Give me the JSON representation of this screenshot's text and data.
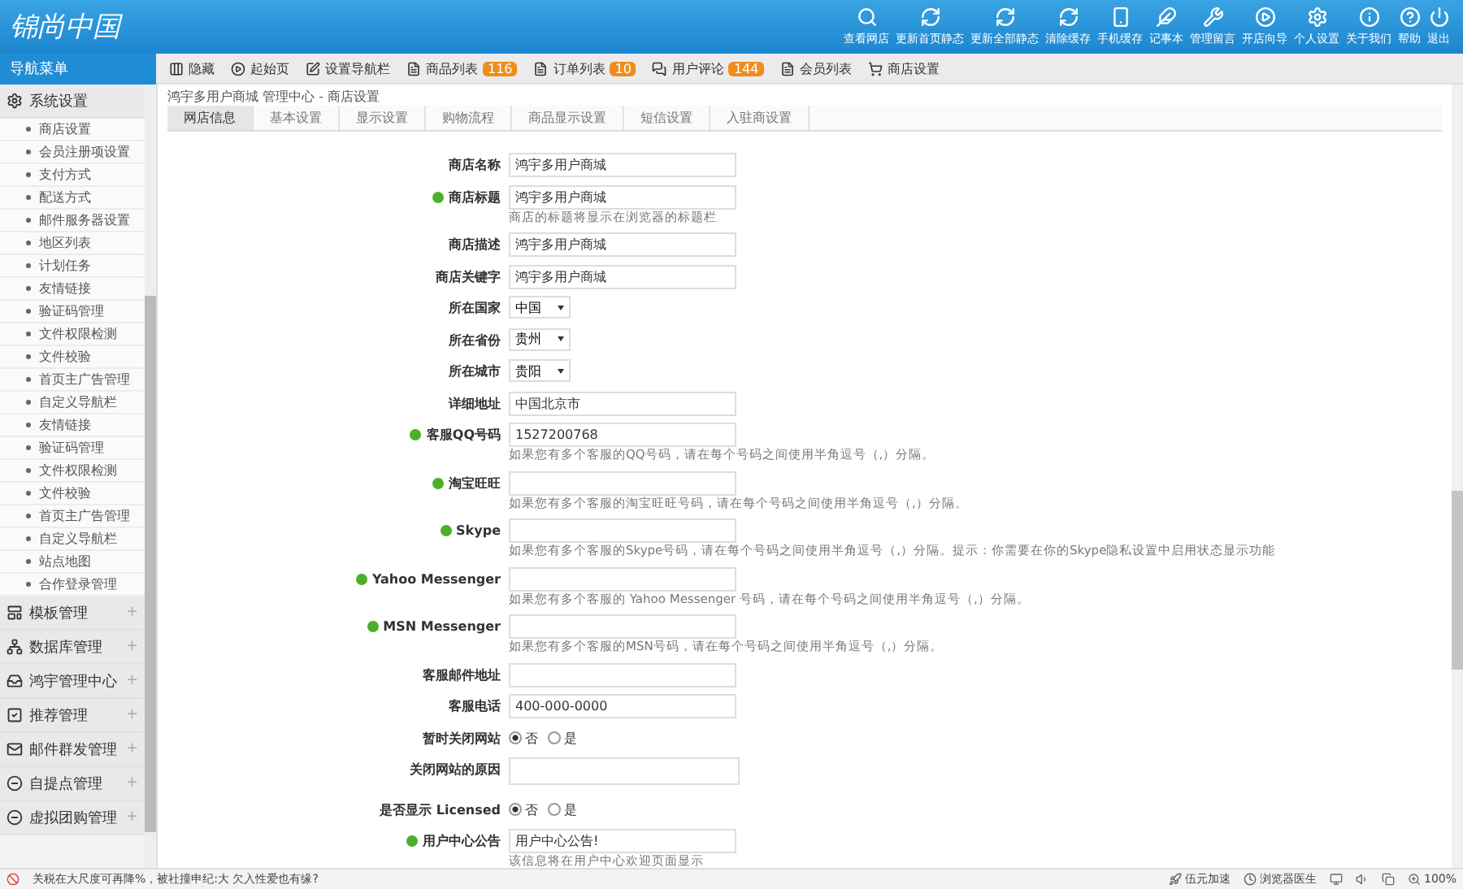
{
  "header": {
    "logo": "锦尚中国",
    "actions": [
      "查看网店",
      "更新首页静态",
      "更新全部静态",
      "清除缓存",
      "手机缓存",
      "记事本",
      "管理留言",
      "开店向导",
      "个人设置",
      "关于我们",
      "帮助",
      "退出"
    ]
  },
  "sidebar": {
    "title": "导航菜单",
    "groups": [
      {
        "label": "系统设置",
        "expanded": true,
        "children": [
          "商店设置",
          "会员注册项设置",
          "支付方式",
          "配送方式",
          "邮件服务器设置",
          "地区列表",
          "计划任务",
          "友情链接",
          "验证码管理",
          "文件权限检测",
          "文件校验",
          "首页主广告管理",
          "自定义导航栏",
          "友情链接",
          "验证码管理",
          "文件权限检测",
          "文件校验",
          "首页主广告管理",
          "自定义导航栏",
          "站点地图",
          "合作登录管理"
        ]
      },
      {
        "label": "模板管理",
        "expanded": false,
        "toggle": "+"
      },
      {
        "label": "数据库管理",
        "expanded": false,
        "toggle": "+"
      },
      {
        "label": "鸿宇管理中心",
        "expanded": false,
        "toggle": "+"
      },
      {
        "label": "推荐管理",
        "expanded": false,
        "toggle": "+"
      },
      {
        "label": "邮件群发管理",
        "expanded": false,
        "toggle": "+"
      },
      {
        "label": "自提点管理",
        "expanded": false,
        "toggle": "+"
      },
      {
        "label": "虚拟团购管理",
        "expanded": false,
        "toggle": "+"
      }
    ]
  },
  "toolbar": [
    {
      "label": "隐藏"
    },
    {
      "label": "起始页"
    },
    {
      "label": "设置导航栏"
    },
    {
      "label": "商品列表",
      "badge": "116"
    },
    {
      "label": "订单列表",
      "badge": "10"
    },
    {
      "label": "用户评论",
      "badge": "144"
    },
    {
      "label": "会员列表"
    },
    {
      "label": "商店设置"
    }
  ],
  "breadcrumb": "鸿宇多用户商城 管理中心 - 商店设置",
  "tabs": [
    {
      "label": "网店信息",
      "selected": true
    },
    {
      "label": "基本设置",
      "selected": false
    },
    {
      "label": "显示设置",
      "selected": false
    },
    {
      "label": "购物流程",
      "selected": false
    },
    {
      "label": "商品显示设置",
      "selected": false
    },
    {
      "label": "短信设置",
      "selected": false
    },
    {
      "label": "入驻商设置",
      "selected": false
    }
  ],
  "form": [
    {
      "kind": "text",
      "label": "商店名称",
      "info": false,
      "value": "鸿宇多用户商城"
    },
    {
      "kind": "text",
      "label": "商店标题",
      "info": true,
      "value": "鸿宇多用户商城",
      "hint": "商店的标题将显示在浏览器的标题栏"
    },
    {
      "kind": "text",
      "label": "商店描述",
      "info": false,
      "value": "鸿宇多用户商城"
    },
    {
      "kind": "text",
      "label": "商店关键字",
      "info": false,
      "value": "鸿宇多用户商城"
    },
    {
      "kind": "select",
      "label": "所在国家",
      "info": false,
      "value": "中国"
    },
    {
      "kind": "select",
      "label": "所在省份",
      "info": false,
      "value": "贵州"
    },
    {
      "kind": "select",
      "label": "所在城市",
      "info": false,
      "value": "贵阳"
    },
    {
      "kind": "text",
      "label": "详细地址",
      "info": false,
      "value": "中国北京市"
    },
    {
      "kind": "text",
      "label": "客服QQ号码",
      "info": true,
      "value": "1527200768",
      "hint": "如果您有多个客服的QQ号码，请在每个号码之间使用半角逗号（,）分隔。"
    },
    {
      "kind": "text",
      "label": "淘宝旺旺",
      "info": true,
      "hint": "如果您有多个客服的淘宝旺旺号码，请在每个号码之间使用半角逗号（,）分隔。"
    },
    {
      "kind": "text",
      "label": "Skype",
      "info": true,
      "hint": "如果您有多个客服的Skype号码，请在每个号码之间使用半角逗号（,）分隔。提示：你需要在你的Skype隐私设置中启用状态显示功能"
    },
    {
      "kind": "text",
      "label": "Yahoo Messenger",
      "info": true,
      "hint": "如果您有多个客服的 Yahoo Messenger 号码，请在每个号码之间使用半角逗号（,）分隔。"
    },
    {
      "kind": "text",
      "label": "MSN Messenger",
      "info": true,
      "hint": "如果您有多个客服的MSN号码，请在每个号码之间使用半角逗号（,）分隔。"
    },
    {
      "kind": "text",
      "label": "客服邮件地址",
      "info": false
    },
    {
      "kind": "text",
      "label": "客服电话",
      "info": false,
      "value": "400-000-0000"
    },
    {
      "kind": "radio",
      "label": "暂时关闭网站",
      "info": false,
      "options": [
        {
          "label": "否",
          "selected": true
        },
        {
          "label": "是",
          "selected": false
        }
      ]
    },
    {
      "kind": "textarea",
      "label": "关闭网站的原因",
      "info": false
    },
    {
      "kind": "radio",
      "label": "是否显示 Licensed",
      "info": false,
      "options": [
        {
          "label": "否",
          "selected": true
        },
        {
          "label": "是",
          "selected": false
        }
      ]
    },
    {
      "kind": "text",
      "label": "用户中心公告",
      "info": true,
      "value": "用户中心公告!",
      "hint": "该信息将在用户中心欢迎页面显示"
    }
  ],
  "status_bar": {
    "news": "关税在大尺度可再降%，被社撞申纪:大 欠入性爱也有缘?",
    "items": [
      "伍元加速",
      "浏览器医生"
    ],
    "zoom": "100%"
  }
}
